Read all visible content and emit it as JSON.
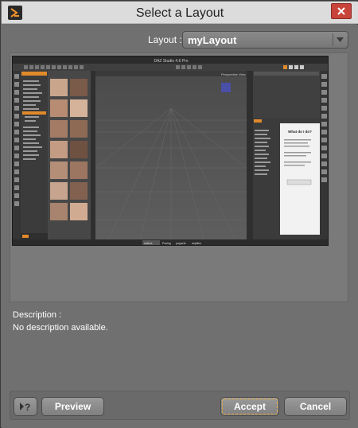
{
  "window": {
    "title": "Select a Layout",
    "icon": "app-logo-icon",
    "close_icon": "close-icon"
  },
  "layout": {
    "label": "Layout :",
    "selected": "myLayout",
    "arrow_icon": "chevron-down-icon"
  },
  "preview": {
    "app_title": "DAZ Studio 4.6 Pro",
    "panel_title": "What do I do?",
    "viewport_label": "Perspective View",
    "bottom_tabs": [
      "editors",
      "Posing",
      "puppets",
      "anyfiles"
    ]
  },
  "description": {
    "label": "Description :",
    "text": "No description available."
  },
  "buttons": {
    "help_icon": "help-icon",
    "preview": "Preview",
    "accept": "Accept",
    "cancel": "Cancel"
  },
  "colors": {
    "titlebar": "#dcdcdc",
    "client": "#707070",
    "close": "#c8433a",
    "accent_focus": "#e8a83c"
  }
}
